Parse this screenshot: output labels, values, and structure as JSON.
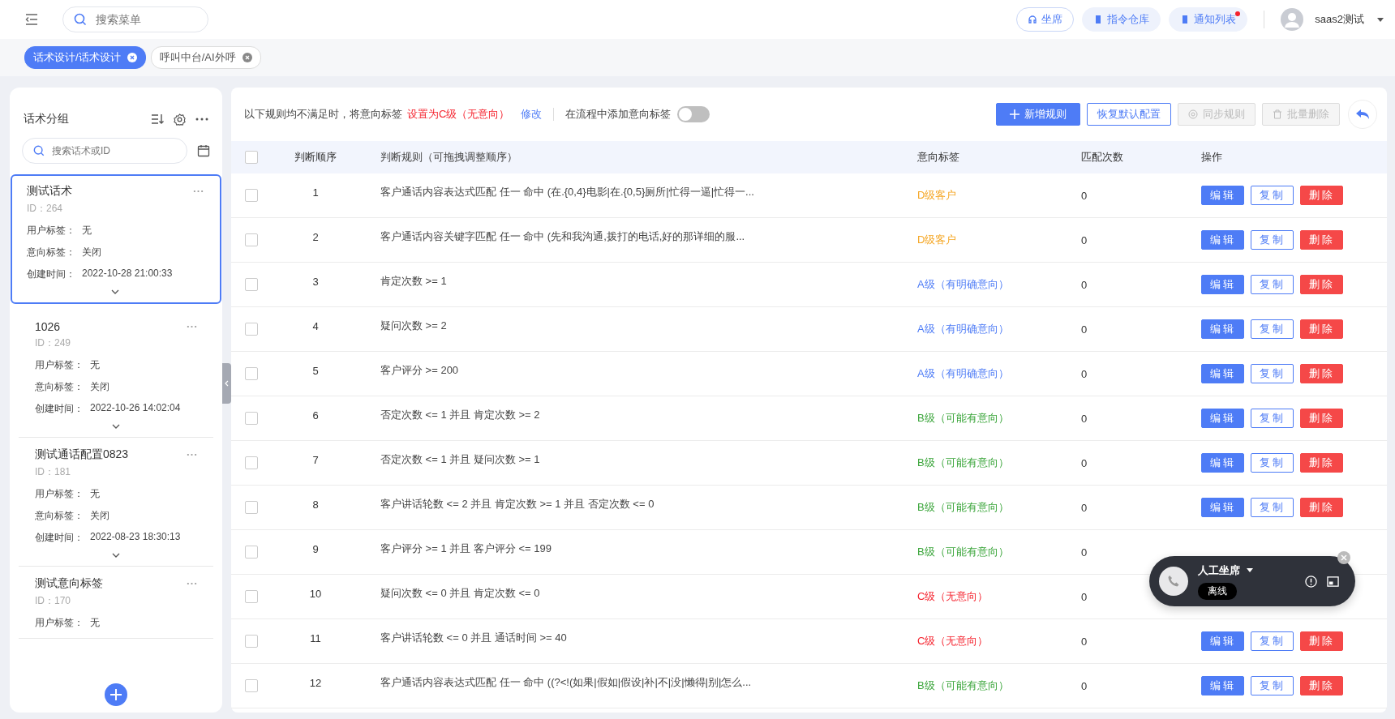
{
  "topbar": {
    "search": {
      "placeholder": "搜索菜单"
    },
    "buttons": [
      {
        "label": "坐席",
        "kind": "outline",
        "badge": false
      },
      {
        "label": "指令仓库",
        "kind": "soft",
        "badge": false
      },
      {
        "label": "通知列表",
        "kind": "soft",
        "badge": true
      }
    ],
    "user": {
      "name": "saas2测试"
    }
  },
  "tabs": [
    {
      "label": "话术设计/话术设计",
      "selected": true
    },
    {
      "label": "呼叫中台/AI外呼",
      "selected": false
    }
  ],
  "sidebar": {
    "title": "话术分组",
    "search": {
      "placeholder": "搜索话术或ID"
    },
    "items": [
      {
        "name": "测试话术",
        "id": "ID：264",
        "selected": true,
        "fields": [
          {
            "label": "用户标签：",
            "value": "无"
          },
          {
            "label": "意向标签：",
            "value": "关闭"
          },
          {
            "label": "创建时间：",
            "value": "2022-10-28 21:00:33"
          }
        ],
        "expandable": true
      },
      {
        "name": "1026",
        "id": "ID：249",
        "selected": false,
        "fields": [
          {
            "label": "用户标签：",
            "value": "无"
          },
          {
            "label": "意向标签：",
            "value": "关闭"
          },
          {
            "label": "创建时间：",
            "value": "2022-10-26 14:02:04"
          }
        ],
        "expandable": true
      },
      {
        "name": "测试通话配置0823",
        "id": "ID：181",
        "selected": false,
        "fields": [
          {
            "label": "用户标签：",
            "value": "无"
          },
          {
            "label": "意向标签：",
            "value": "关闭"
          },
          {
            "label": "创建时间：",
            "value": "2022-08-23 18:30:13"
          }
        ],
        "expandable": true
      },
      {
        "name": "测试意向标签",
        "id": "ID：170",
        "selected": false,
        "fields": [
          {
            "label": "用户标签：",
            "value": "无"
          }
        ],
        "expandable": false
      }
    ]
  },
  "toolbar": {
    "notice": "以下规则均不满足时，将意向标签",
    "default_tag": "设置为C级（无意向）",
    "edit_link": "修改",
    "switch_label": "在流程中添加意向标签",
    "switch_on": false,
    "buttons": [
      {
        "label": "新增规则",
        "kind": "primary",
        "disabled": false
      },
      {
        "label": "恢复默认配置",
        "kind": "outline",
        "disabled": false
      },
      {
        "label": "同步规则",
        "kind": "sync",
        "disabled": true
      },
      {
        "label": "批量删除",
        "kind": "trash",
        "disabled": true
      }
    ]
  },
  "table": {
    "all_checked": false,
    "columns": [
      "判断顺序",
      "判断规则（可拖拽调整顺序）",
      "意向标签",
      "匹配次数",
      "操作"
    ],
    "rows": [
      {
        "order": "1",
        "rule": "客户通话内容表达式匹配 任一 命中 (在.{0,4}电影|在.{0,5}厕所|忙得一逼|忙得一...",
        "tag": "D级客户",
        "color": "#f5a623",
        "count": "0",
        "checked": false,
        "actions": [
          {
            "label": "编辑",
            "kind": "edit"
          },
          {
            "label": "复制",
            "kind": "copy"
          },
          {
            "label": "删除",
            "kind": "delete"
          }
        ]
      },
      {
        "order": "2",
        "rule": "客户通话内容关键字匹配 任一 命中 (先和我沟通,拨打的电话,好的那详细的服...",
        "tag": "D级客户",
        "color": "#f5a623",
        "count": "0",
        "checked": false,
        "actions": [
          {
            "label": "编辑",
            "kind": "edit"
          },
          {
            "label": "复制",
            "kind": "copy"
          },
          {
            "label": "删除",
            "kind": "delete"
          }
        ]
      },
      {
        "order": "3",
        "rule": "肯定次数 >= 1",
        "tag": "A级（有明确意向）",
        "color": "#4e7cf6",
        "count": "0",
        "checked": false,
        "actions": [
          {
            "label": "编辑",
            "kind": "edit"
          },
          {
            "label": "复制",
            "kind": "copy"
          },
          {
            "label": "删除",
            "kind": "delete"
          }
        ]
      },
      {
        "order": "4",
        "rule": "疑问次数 >= 2",
        "tag": "A级（有明确意向）",
        "color": "#4e7cf6",
        "count": "0",
        "checked": false,
        "actions": [
          {
            "label": "编辑",
            "kind": "edit"
          },
          {
            "label": "复制",
            "kind": "copy"
          },
          {
            "label": "删除",
            "kind": "delete"
          }
        ]
      },
      {
        "order": "5",
        "rule": "客户评分 >= 200",
        "tag": "A级（有明确意向）",
        "color": "#4e7cf6",
        "count": "0",
        "checked": false,
        "actions": [
          {
            "label": "编辑",
            "kind": "edit"
          },
          {
            "label": "复制",
            "kind": "copy"
          },
          {
            "label": "删除",
            "kind": "delete"
          }
        ]
      },
      {
        "order": "6",
        "rule": "否定次数 <= 1 并且 肯定次数 >= 2",
        "tag": "B级（可能有意向）",
        "color": "#3aa53a",
        "count": "0",
        "checked": false,
        "actions": [
          {
            "label": "编辑",
            "kind": "edit"
          },
          {
            "label": "复制",
            "kind": "copy"
          },
          {
            "label": "删除",
            "kind": "delete"
          }
        ]
      },
      {
        "order": "7",
        "rule": "否定次数 <= 1 并且 疑问次数 >= 1",
        "tag": "B级（可能有意向）",
        "color": "#3aa53a",
        "count": "0",
        "checked": false,
        "actions": [
          {
            "label": "编辑",
            "kind": "edit"
          },
          {
            "label": "复制",
            "kind": "copy"
          },
          {
            "label": "删除",
            "kind": "delete"
          }
        ]
      },
      {
        "order": "8",
        "rule": "客户讲话轮数 <= 2 并且 肯定次数 >= 1 并且 否定次数 <= 0",
        "tag": "B级（可能有意向）",
        "color": "#3aa53a",
        "count": "0",
        "checked": false,
        "actions": [
          {
            "label": "编辑",
            "kind": "edit"
          },
          {
            "label": "复制",
            "kind": "copy"
          },
          {
            "label": "删除",
            "kind": "delete"
          }
        ]
      },
      {
        "order": "9",
        "rule": "客户评分 >= 1 并且 客户评分 <= 199",
        "tag": "B级（可能有意向）",
        "color": "#3aa53a",
        "count": "0",
        "checked": false
      },
      {
        "order": "10",
        "rule": "疑问次数 <= 0 并且 肯定次数 <= 0",
        "tag": "C级（无意向）",
        "color": "#f5222d",
        "count": "0",
        "checked": false
      },
      {
        "order": "11",
        "rule": "客户讲话轮数 <= 0 并且 通话时间 >= 40",
        "tag": "C级（无意向）",
        "color": "#f5222d",
        "count": "0",
        "checked": false,
        "actions": [
          {
            "label": "编辑",
            "kind": "edit"
          },
          {
            "label": "复制",
            "kind": "copy"
          },
          {
            "label": "删除",
            "kind": "delete"
          }
        ]
      },
      {
        "order": "12",
        "rule": "客户通话内容表达式匹配 任一 命中 ((?<!(如果|假如|假设|补|不|没|懒得|别|怎么...",
        "tag": "B级（可能有意向）",
        "color": "#3aa53a",
        "count": "0",
        "checked": false,
        "actions": [
          {
            "label": "编辑",
            "kind": "edit"
          },
          {
            "label": "复制",
            "kind": "copy"
          },
          {
            "label": "删除",
            "kind": "delete"
          }
        ]
      }
    ]
  },
  "call_widget": {
    "title": "人工坐席",
    "status": "离线"
  }
}
